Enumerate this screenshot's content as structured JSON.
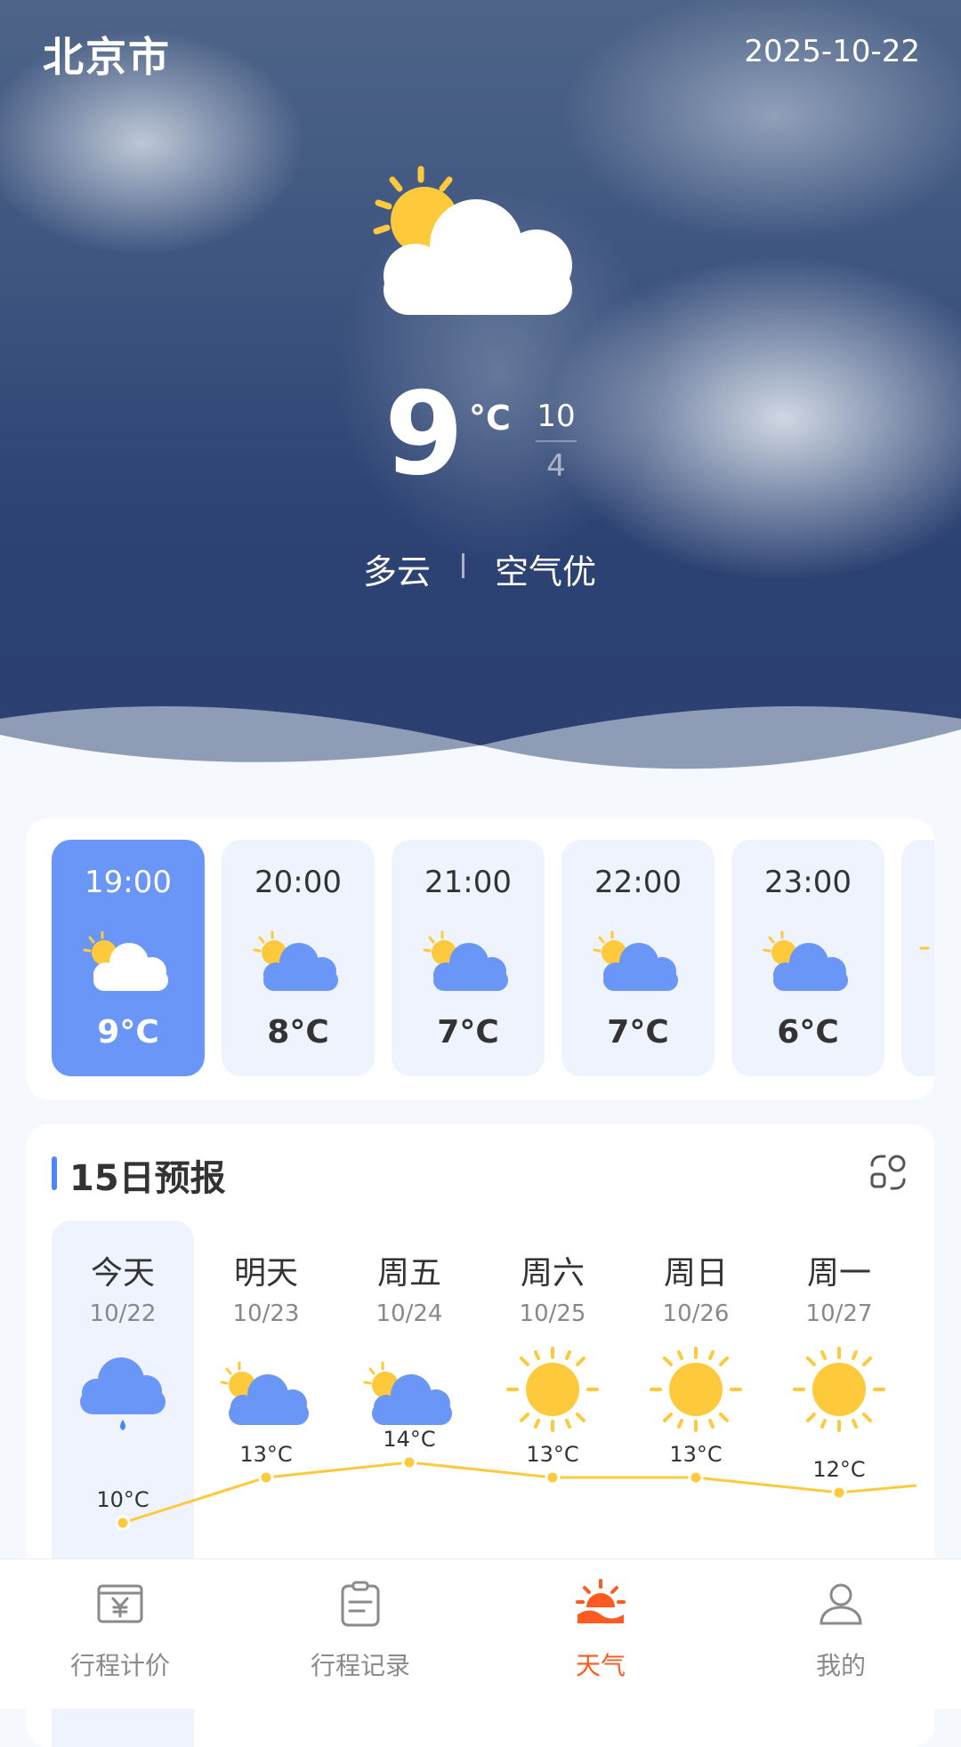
{
  "header": {
    "city": "北京市",
    "date": "2025-10-22"
  },
  "current": {
    "temp": "9",
    "unit": "°C",
    "high": "10",
    "low": "4",
    "condition": "多云",
    "air_quality": "空气优",
    "icon": "partly-cloudy-icon"
  },
  "hourly": [
    {
      "time": "19:00",
      "temp": "9°C",
      "icon": "partly-cloudy-icon",
      "active": true
    },
    {
      "time": "20:00",
      "temp": "8°C",
      "icon": "partly-cloudy-icon"
    },
    {
      "time": "21:00",
      "temp": "7°C",
      "icon": "partly-cloudy-icon"
    },
    {
      "time": "22:00",
      "temp": "7°C",
      "icon": "partly-cloudy-icon"
    },
    {
      "time": "23:00",
      "temp": "6°C",
      "icon": "partly-cloudy-icon"
    }
  ],
  "daily": {
    "title": "15日预报",
    "days": [
      {
        "name": "今天",
        "date": "10/22",
        "icon": "rain-icon",
        "high": 10,
        "high_label": "10°C"
      },
      {
        "name": "明天",
        "date": "10/23",
        "icon": "partly-cloudy-icon",
        "high": 13,
        "high_label": "13°C"
      },
      {
        "name": "周五",
        "date": "10/24",
        "icon": "partly-cloudy-icon",
        "high": 14,
        "high_label": "14°C"
      },
      {
        "name": "周六",
        "date": "10/25",
        "icon": "sunny-icon",
        "high": 13,
        "high_label": "13°C"
      },
      {
        "name": "周日",
        "date": "10/26",
        "icon": "sunny-icon",
        "high": 13,
        "high_label": "13°C"
      },
      {
        "name": "周一",
        "date": "10/27",
        "icon": "sunny-icon",
        "high": 12,
        "high_label": "12°C"
      }
    ]
  },
  "nav": {
    "items": [
      {
        "label": "行程计价",
        "icon": "fare-icon"
      },
      {
        "label": "行程记录",
        "icon": "record-icon"
      },
      {
        "label": "天气",
        "icon": "weather-icon",
        "active": true
      },
      {
        "label": "我的",
        "icon": "profile-icon"
      }
    ]
  },
  "colors": {
    "accent_blue": "#6a96f8",
    "nav_active": "#ff5a1f",
    "sun": "#ffc93c",
    "chart_line": "#ffc93c"
  }
}
